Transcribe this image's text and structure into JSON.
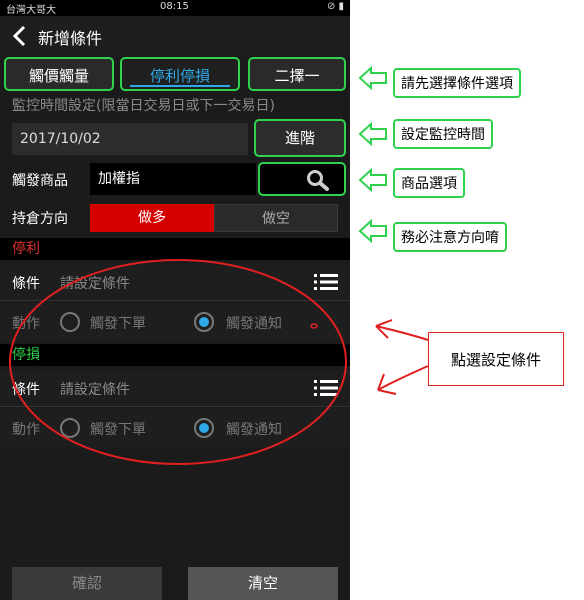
{
  "statusbar": {
    "carrier": "台灣大哥大",
    "time": "08:15",
    "icons": "⊘ ▮"
  },
  "header": {
    "title": "新增條件"
  },
  "tabs": [
    {
      "label": "觸價觸量"
    },
    {
      "label": "停利停損"
    },
    {
      "label": "二擇一"
    }
  ],
  "monitor": {
    "label": "監控時間設定(限當日交易日或下一交易日)",
    "date": "2017/10/02",
    "advanced_label": "進階"
  },
  "product": {
    "label": "觸發商品",
    "value": "加權指"
  },
  "direction": {
    "label": "持倉方向",
    "long": "做多",
    "short": "做空"
  },
  "take_profit": {
    "title": "停利",
    "cond_label": "條件",
    "cond_placeholder": "請設定條件",
    "action_label": "動作",
    "opt1": "觸發下單",
    "opt2": "觸發通知"
  },
  "stop_loss": {
    "title": "停損",
    "cond_label": "條件",
    "cond_placeholder": "請設定條件",
    "action_label": "動作",
    "opt1": "觸發下單",
    "opt2": "觸發通知"
  },
  "footer": {
    "confirm": "確認",
    "clear": "清空"
  },
  "annotations": {
    "tip1": "請先選擇條件選項",
    "tip2": "設定監控時間",
    "tip3": "商品選項",
    "tip4": "務必注意方向唷",
    "tip5": "點選設定條件"
  },
  "colors": {
    "accent_blue": "#2ea8e6",
    "long_red": "#d40000",
    "profit_red": "#e03030",
    "loss_green": "#2fd24e",
    "callout_green": "#2fd24e"
  }
}
